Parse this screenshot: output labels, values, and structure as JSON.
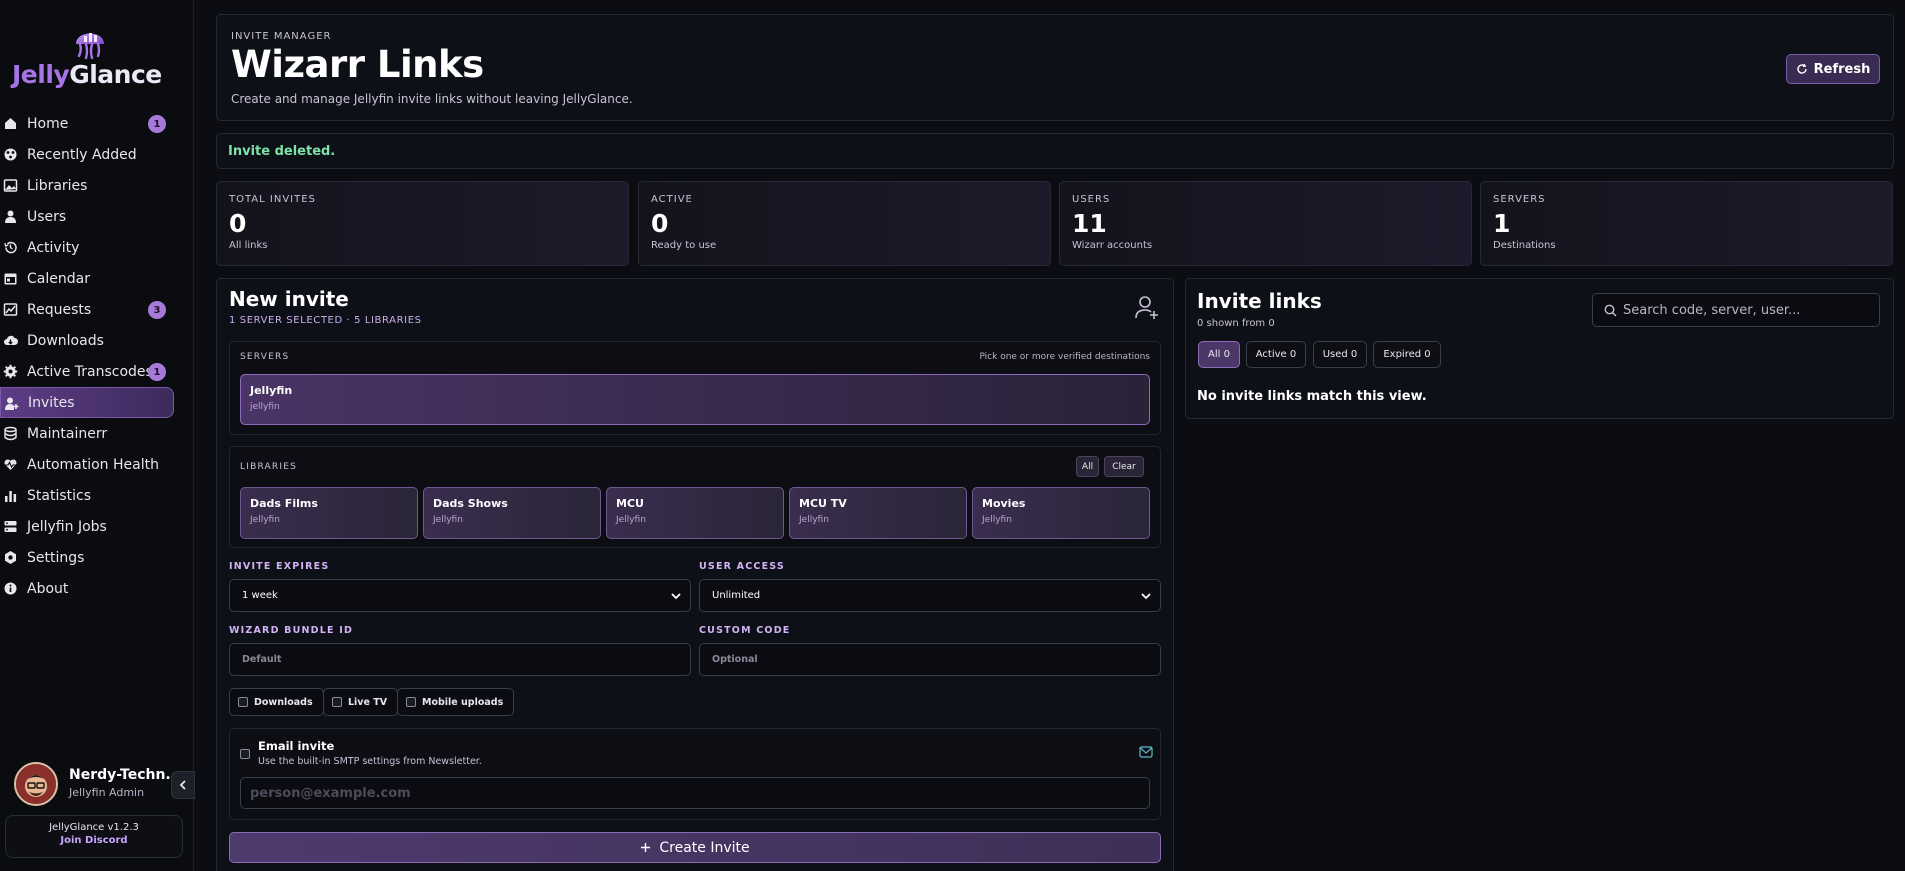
{
  "app": {
    "logo_part1": "Jelly",
    "logo_part2": "Glance",
    "version": "JellyGlance v1.2.3",
    "discord": "Join Discord"
  },
  "sidebar": {
    "items": [
      {
        "label": "Home",
        "icon": "home-icon",
        "badge": "1"
      },
      {
        "label": "Recently Added",
        "icon": "film-reel-icon",
        "badge": ""
      },
      {
        "label": "Libraries",
        "icon": "image-library-icon",
        "badge": ""
      },
      {
        "label": "Users",
        "icon": "user-icon",
        "badge": ""
      },
      {
        "label": "Activity",
        "icon": "history-icon",
        "badge": ""
      },
      {
        "label": "Calendar",
        "icon": "calendar-icon",
        "badge": ""
      },
      {
        "label": "Requests",
        "icon": "chart-line-icon",
        "badge": "3"
      },
      {
        "label": "Downloads",
        "icon": "cloud-download-icon",
        "badge": ""
      },
      {
        "label": "Active Transcodes",
        "icon": "gear-icon",
        "badge": "1"
      },
      {
        "label": "Invites",
        "icon": "user-plus-icon",
        "badge": ""
      },
      {
        "label": "Maintainerr",
        "icon": "database-icon",
        "badge": ""
      },
      {
        "label": "Automation Health",
        "icon": "heart-pulse-icon",
        "badge": ""
      },
      {
        "label": "Statistics",
        "icon": "bar-chart-icon",
        "badge": ""
      },
      {
        "label": "Jellyfin Jobs",
        "icon": "server-icon",
        "badge": ""
      },
      {
        "label": "Settings",
        "icon": "settings-icon",
        "badge": ""
      },
      {
        "label": "About",
        "icon": "info-icon",
        "badge": ""
      }
    ],
    "active_index": 9
  },
  "user": {
    "name": "Nerdy-Techn...",
    "role": "Jellyfin Admin"
  },
  "header": {
    "eyebrow": "INVITE MANAGER",
    "title": "Wizarr Links",
    "subtitle": "Create and manage Jellyfin invite links without leaving JellyGlance.",
    "refresh_label": "Refresh"
  },
  "notice": "Invite deleted.",
  "stats": [
    {
      "label": "TOTAL INVITES",
      "value": "0",
      "sub": "All links"
    },
    {
      "label": "ACTIVE",
      "value": "0",
      "sub": "Ready to use"
    },
    {
      "label": "USERS",
      "value": "11",
      "sub": "Wizarr accounts"
    },
    {
      "label": "SERVERS",
      "value": "1",
      "sub": "Destinations"
    }
  ],
  "new_invite": {
    "title": "New invite",
    "subtitle": "1 SERVER SELECTED · 5 LIBRARIES",
    "servers": {
      "label": "SERVERS",
      "hint": "Pick one or more verified destinations",
      "items": [
        {
          "name": "Jellyfin",
          "type": "jellyfin"
        }
      ]
    },
    "libraries": {
      "label": "LIBRARIES",
      "all_label": "All",
      "clear_label": "Clear",
      "items": [
        {
          "name": "Dads Films",
          "server": "Jellyfin"
        },
        {
          "name": "Dads Shows",
          "server": "Jellyfin"
        },
        {
          "name": "MCU",
          "server": "Jellyfin"
        },
        {
          "name": "MCU TV",
          "server": "Jellyfin"
        },
        {
          "name": "Movies",
          "server": "Jellyfin"
        }
      ]
    },
    "expires_label": "INVITE EXPIRES",
    "expires_value": "1 week",
    "access_label": "USER ACCESS",
    "access_value": "Unlimited",
    "bundle_label": "WIZARD BUNDLE ID",
    "bundle_placeholder": "Default",
    "code_label": "CUSTOM CODE",
    "code_placeholder": "Optional",
    "checks": [
      "Downloads",
      "Live TV",
      "Mobile uploads"
    ],
    "email": {
      "title": "Email invite",
      "subtitle": "Use the built-in SMTP settings from Newsletter.",
      "placeholder": "person@example.com"
    },
    "create_label": "Create Invite"
  },
  "invite_links": {
    "title": "Invite links",
    "subtitle": "0 shown from 0",
    "search_placeholder": "Search code, server, user...",
    "filters": [
      "All 0",
      "Active 0",
      "Used 0",
      "Expired 0"
    ],
    "active_filter": 0,
    "empty": "No invite links match this view."
  },
  "colors": {
    "accent": "#a774e8",
    "success": "#7ee2a8",
    "badge": "#a57ad8"
  }
}
